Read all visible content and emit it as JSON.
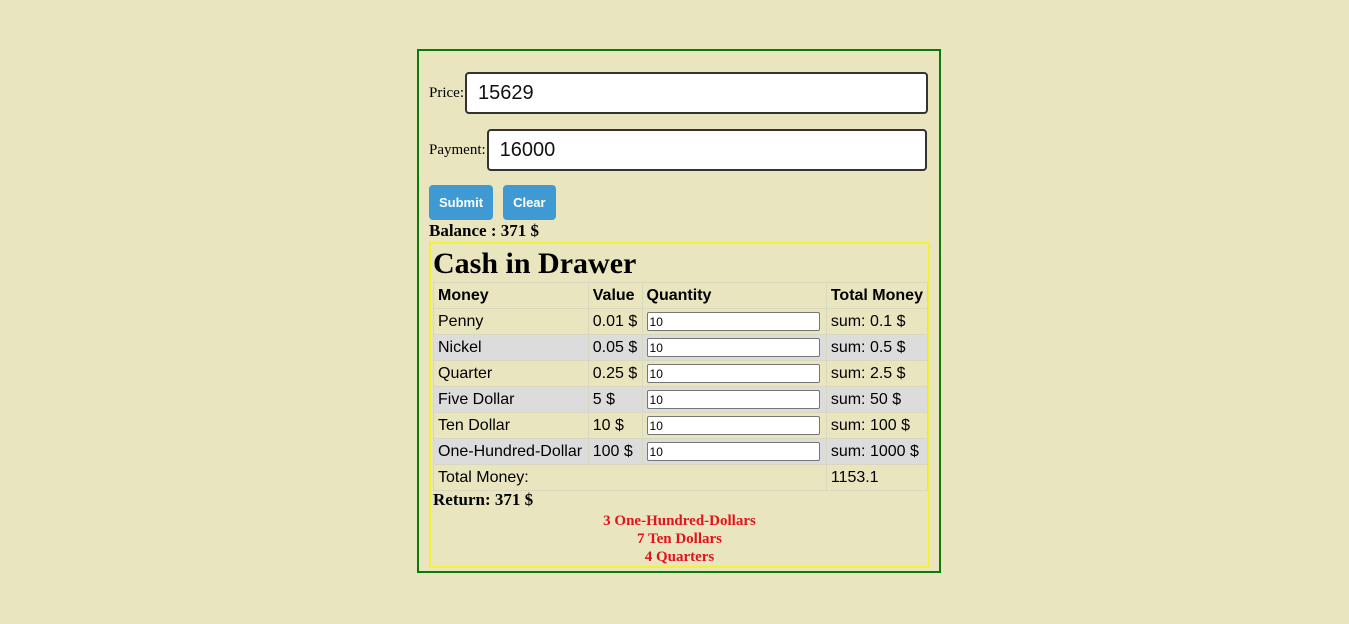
{
  "form": {
    "price_label": "Price:",
    "price_value": "15629",
    "payment_label": "Payment:",
    "payment_value": "16000",
    "submit_label": "Submit",
    "clear_label": "Clear"
  },
  "balance_text": "Balance : 371 $",
  "drawer": {
    "title": "Cash in Drawer",
    "headers": [
      "Money",
      "Value",
      "Quantity",
      "Total Money"
    ],
    "rows": [
      {
        "money": "Penny",
        "value": "0.01 $",
        "quantity": "10",
        "sum": "sum: 0.1 $"
      },
      {
        "money": "Nickel",
        "value": "0.05 $",
        "quantity": "10",
        "sum": "sum: 0.5 $"
      },
      {
        "money": "Quarter",
        "value": "0.25 $",
        "quantity": "10",
        "sum": "sum: 2.5 $"
      },
      {
        "money": "Five Dollar",
        "value": "5 $",
        "quantity": "10",
        "sum": "sum: 50 $"
      },
      {
        "money": "Ten Dollar",
        "value": "10 $",
        "quantity": "10",
        "sum": "sum: 100 $"
      },
      {
        "money": "One-Hundred-Dollar",
        "value": "100 $",
        "quantity": "10",
        "sum": "sum: 1000 $"
      }
    ],
    "total_label": "Total Money:",
    "total_value": "1153.1"
  },
  "return_text": "Return: 371 $",
  "change": [
    "3 One-Hundred-Dollars",
    "7 Ten Dollars",
    "4 Quarters"
  ],
  "colors": {
    "background": "#e8e5bf",
    "container_border": "#0a7a0a",
    "drawer_border": "#f2f23a",
    "button": "#3f9ad4",
    "change_text": "#e0141e"
  }
}
